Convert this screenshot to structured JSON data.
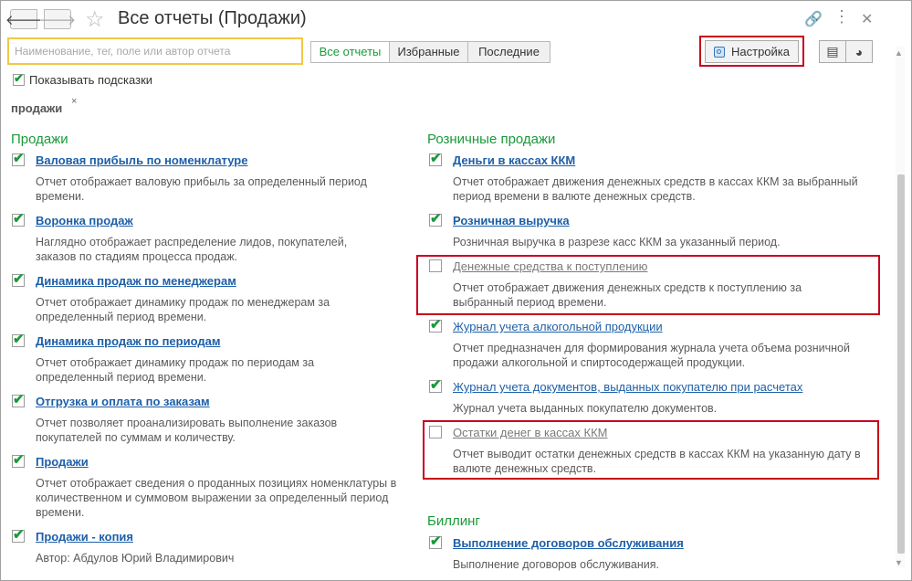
{
  "window": {
    "title": "Все отчеты (Продажи)"
  },
  "search": {
    "placeholder": "Наименование, тег, поле или автор отчета"
  },
  "filters": [
    {
      "label": "Все отчеты",
      "active": true
    },
    {
      "label": "Избранные",
      "active": false
    },
    {
      "label": "Последние",
      "active": false
    }
  ],
  "setup_label": "Настройка",
  "hints": {
    "label": "Показывать подсказки",
    "checked": true
  },
  "tag": {
    "label": "продажи",
    "remove": "×"
  },
  "icons": {
    "back": "arrow-left-icon",
    "forward": "arrow-right-icon",
    "star": "star-icon",
    "link": "link-icon",
    "more": "more-vertical-icon",
    "close": "close-icon",
    "list": "list-view-icon",
    "chart": "pie-chart-icon"
  },
  "colors": {
    "section": "#1a9a3a",
    "link": "#1d5fa8",
    "highlight": "#c8001a",
    "search_border": "#f2c744"
  },
  "left": {
    "section": "Продажи",
    "reports": [
      {
        "title": "Валовая прибыль по номенклатуре",
        "desc": "Отчет отображает валовую прибыль за определенный период времени.",
        "checked": true
      },
      {
        "title": "Воронка продаж",
        "desc": "Наглядно отображает распределение лидов, покупателей, заказов по стадиям процесса продаж.",
        "checked": true
      },
      {
        "title": "Динамика продаж по менеджерам",
        "desc": "Отчет отображает динамику продаж по менеджерам за определенный период времени.",
        "checked": true
      },
      {
        "title": "Динамика продаж по периодам",
        "desc": "Отчет отображает динамику продаж по периодам за определенный период времени.",
        "checked": true
      },
      {
        "title": "Отгрузка и оплата по заказам",
        "desc": "Отчет позволяет проанализировать выполнение заказов покупателей по суммам и количеству.",
        "checked": true
      },
      {
        "title": "Продажи",
        "desc": "Отчет отображает сведения о проданных позициях номенклатуры в количественном и суммовом выражении за определенный период времени.",
        "checked": true
      },
      {
        "title": "Продажи - копия",
        "desc": "Автор: Абдулов Юрий Владимирович",
        "checked": true
      }
    ]
  },
  "right": {
    "section": "Розничные продажи",
    "reports": [
      {
        "title": "Деньги в кассах ККМ",
        "desc": "Отчет отображает движения денежных средств в кассах ККМ за выбранный период времени в валюте денежных средств.",
        "checked": true
      },
      {
        "title": "Розничная выручка",
        "desc": "Розничная выручка в разрезе касс ККМ за указанный период.",
        "checked": true
      },
      {
        "title": "Денежные средства к поступлению",
        "desc": "Отчет отображает движения денежных средств к поступлению за выбранный период времени.",
        "checked": false
      },
      {
        "title": "Журнал учета алкогольной продукции",
        "desc": "Отчет предназначен для формирования журнала учета объема розничной продажи алкогольной и спиртосодержащей продукции.",
        "checked": true
      },
      {
        "title": "Журнал учета документов, выданных покупателю при расчетах",
        "desc": "Журнал учета выданных покупателю документов.",
        "checked": true
      },
      {
        "title": "Остатки денег в кассах ККМ",
        "desc": "Отчет выводит остатки денежных средств в кассах ККМ на указанную дату в валюте денежных средств.",
        "checked": false
      }
    ],
    "section2": "Биллинг",
    "reports2": [
      {
        "title": "Выполнение договоров обслуживания",
        "desc": "Выполнение договоров обслуживания.",
        "checked": true
      }
    ]
  }
}
